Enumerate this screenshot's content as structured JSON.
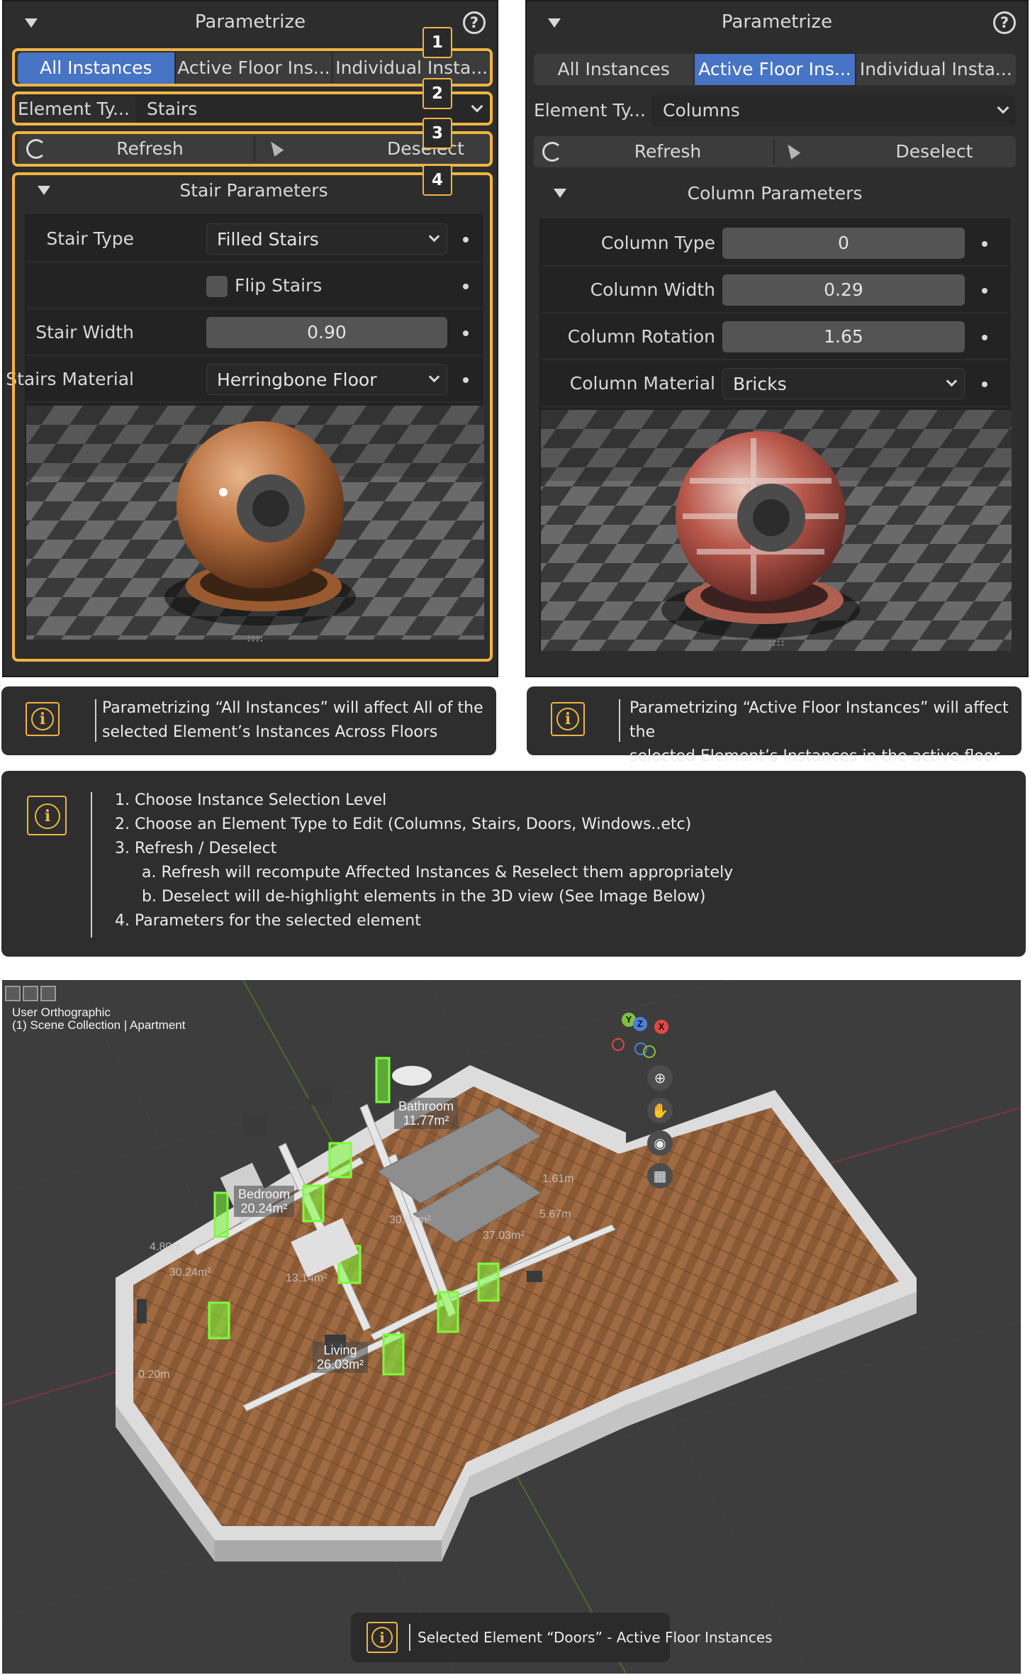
{
  "left_panel": {
    "title": "Parametrize",
    "help_glyph": "?",
    "tabs": [
      {
        "label": "All Instances",
        "active": true
      },
      {
        "label": "Active Floor Ins...",
        "active": false
      },
      {
        "label": "Individual Insta...",
        "active": false
      }
    ],
    "element_type_label": "Element Ty...",
    "element_type_value": "Stairs",
    "refresh_label": "Refresh",
    "deselect_label": "Deselect",
    "section_title": "Stair Parameters",
    "params": {
      "stair_type_label": "Stair Type",
      "stair_type_value": "Filled Stairs",
      "flip_stairs_label": "Flip Stairs",
      "stair_width_label": "Stair Width",
      "stair_width_value": "0.90",
      "stairs_material_label": "Stairs Material",
      "stairs_material_value": "Herringbone Floor"
    },
    "badges": [
      "1",
      "2",
      "3",
      "4"
    ],
    "highlight_color": "#f0b542"
  },
  "right_panel": {
    "title": "Parametrize",
    "help_glyph": "?",
    "tabs": [
      {
        "label": "All Instances",
        "active": false
      },
      {
        "label": "Active Floor Ins...",
        "active": true
      },
      {
        "label": "Individual Insta...",
        "active": false
      }
    ],
    "element_type_label": "Element Ty...",
    "element_type_value": "Columns",
    "refresh_label": "Refresh",
    "deselect_label": "Deselect",
    "section_title": "Column Parameters",
    "params": {
      "column_type_label": "Column Type",
      "column_type_value": "0",
      "column_width_label": "Column Width",
      "column_width_value": "0.29",
      "column_rotation_label": "Column Rotation",
      "column_rotation_value": "1.65",
      "column_material_label": "Column Material",
      "column_material_value": "Bricks"
    }
  },
  "info_left": {
    "icon": "info-icon",
    "line1": "Parametrizing “All Instances” will affect All of the",
    "line2": "selected Element’s Instances Across Floors"
  },
  "info_right": {
    "icon": "info-icon",
    "line1": "Parametrizing “Active Floor Instances” will affect the",
    "line2": "selected Element’s Instances in the active floor"
  },
  "steps": {
    "s1": "1. Choose Instance Selection Level",
    "s2": "2. Choose an Element Type to Edit (Columns, Stairs, Doors, Windows..etc)",
    "s3": "3. Refresh / Deselect",
    "s3a": "a. Refresh will recompute Affected Instances & Reselect them appropriately",
    "s3b": "b. Deselect will de-highlight elements in the 3D view (See Image Below)",
    "s4": "4. Parameters for the selected element"
  },
  "viewport": {
    "view_name": "User Orthographic",
    "collection_prefix": "(1) Scene Collection",
    "collection_name": "Apartment",
    "gizmo": {
      "y": "Y",
      "z": "Z",
      "x": "X"
    },
    "nav_icons": [
      "zoom-icon",
      "pan-hand-icon",
      "camera-icon",
      "grid-icon"
    ],
    "rooms": [
      {
        "name": "Bathroom",
        "area": "11.77m²"
      },
      {
        "name": "Bedroom",
        "area": "20.24m²"
      },
      {
        "name": "Living",
        "area": "26.03m²"
      }
    ],
    "dims": [
      "30.24m²",
      "37.03m²",
      "30.92m²",
      "4.80m",
      "1.61m",
      "5.67m",
      "13.14m²",
      "0.20m"
    ],
    "selection_color": "#7cff3a"
  },
  "info_bottom": {
    "icon": "info-icon",
    "text": "Selected Element “Doors” - Active Floor Instances"
  }
}
